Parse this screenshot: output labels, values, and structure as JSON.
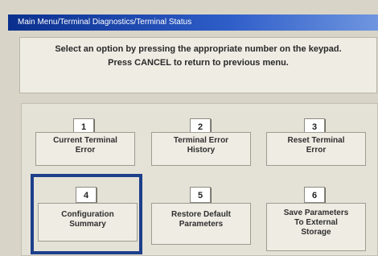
{
  "window": {
    "title": "Main Menu/Terminal Diagnostics/Terminal Status"
  },
  "instructions": {
    "line1": "Select an option by pressing the appropriate number on the keypad.",
    "line2": "Press CANCEL to return to previous menu."
  },
  "options": [
    {
      "number": "1",
      "label_line1": "Current Terminal",
      "label_line2": "Error",
      "label_line3": ""
    },
    {
      "number": "2",
      "label_line1": "Terminal Error",
      "label_line2": "History",
      "label_line3": ""
    },
    {
      "number": "3",
      "label_line1": "Reset Terminal",
      "label_line2": "Error",
      "label_line3": ""
    },
    {
      "number": "4",
      "label_line1": "Configuration",
      "label_line2": "Summary",
      "label_line3": ""
    },
    {
      "number": "5",
      "label_line1": "Restore Default",
      "label_line2": "Parameters",
      "label_line3": ""
    },
    {
      "number": "6",
      "label_line1": "Save Parameters",
      "label_line2": "To External",
      "label_line3": "Storage"
    }
  ],
  "highlight": {
    "selected_option": "4",
    "color": "#1c3f8a"
  }
}
